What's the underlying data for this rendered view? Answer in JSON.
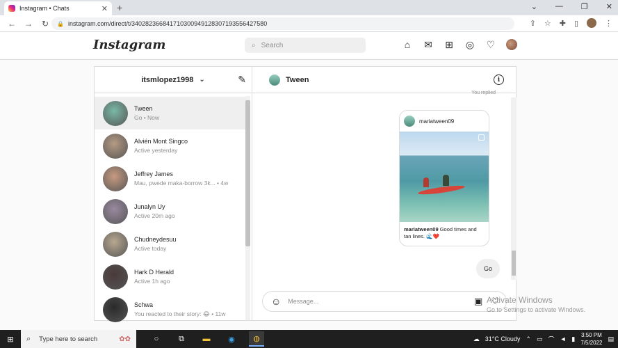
{
  "browser": {
    "tab_title": "Instagram • Chats",
    "url": "instagram.com/direct/t/340282366841710300949128307193556427580"
  },
  "header": {
    "logo": "Instagram",
    "search_placeholder": "Search"
  },
  "inbox": {
    "username": "itsmlopez1998",
    "conversations": [
      {
        "name": "Tween",
        "sub": "Go • Now",
        "color": "#7ab8a5"
      },
      {
        "name": "Alvién Mont Singco",
        "sub": "Active yesterday",
        "color": "#b59a83"
      },
      {
        "name": "Jeffrey James",
        "sub": "Mau, pwede maka-borrow 3k... • 4w",
        "color": "#c89a80"
      },
      {
        "name": "Junalyn Uy",
        "sub": "Active 20m ago",
        "color": "#9a8aa0"
      },
      {
        "name": "Chudneydesuu",
        "sub": "Active today",
        "color": "#b8a890"
      },
      {
        "name": "Hark D Herald",
        "sub": "Active 1h ago",
        "color": "#4a3a3a"
      },
      {
        "name": "Schwa",
        "sub": "You reacted to their story: 😂 • 11w",
        "color": "#2a2a2a"
      }
    ]
  },
  "chat": {
    "title": "Tween",
    "partial_top_text": "You replied",
    "post": {
      "author": "mariatween09",
      "caption_user": "mariatween09",
      "caption_text": "Good times and tan lines. 🌊❤️"
    },
    "message": "Go",
    "composer_placeholder": "Message..."
  },
  "watermark": {
    "line1": "Activate Windows",
    "line2": "Go to Settings to activate Windows."
  },
  "taskbar": {
    "search_text": "Type here to search",
    "weather": "31°C  Cloudy",
    "time": "3:50 PM",
    "date": "7/5/2022"
  }
}
